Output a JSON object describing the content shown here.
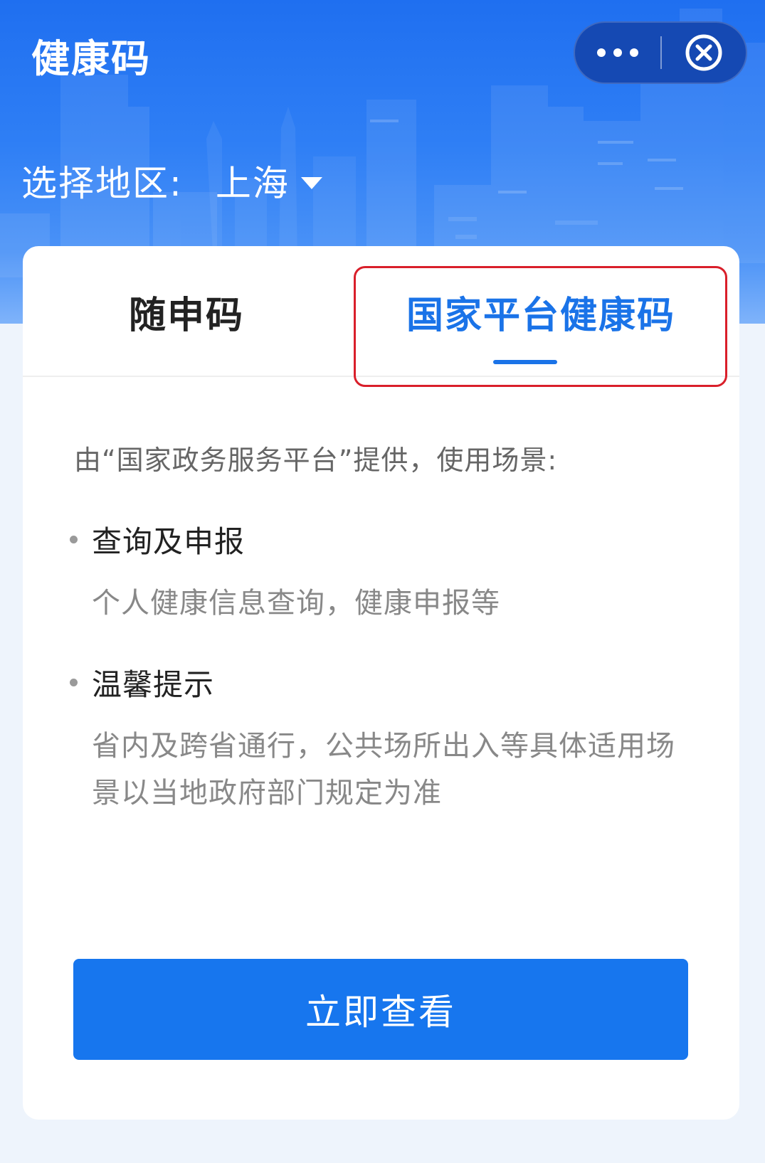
{
  "app": {
    "title": "健康码",
    "region_label": "选择地区:",
    "region_value": "上海"
  },
  "capsule": {
    "more_icon": "more-dots-icon",
    "close_icon": "close-circle-icon"
  },
  "tabs": [
    {
      "label": "随申码",
      "active": false
    },
    {
      "label": "国家平台健康码",
      "active": true
    }
  ],
  "content": {
    "intro": "由“国家政务服务平台”提供，使用场景:",
    "items": [
      {
        "title": "查询及申报",
        "desc": "个人健康信息查询，健康申报等"
      },
      {
        "title": "温馨提示",
        "desc": "省内及跨省通行，公共场所出入等具体适用场景以当地政府部门规定为准"
      }
    ]
  },
  "button": {
    "label": "立即查看"
  },
  "colors": {
    "header_blue": "#1f6ff0",
    "accent_blue": "#1a73e8",
    "button_blue": "#1776ee",
    "highlight_red": "#d91f2a",
    "page_bg": "#eef4fc"
  }
}
